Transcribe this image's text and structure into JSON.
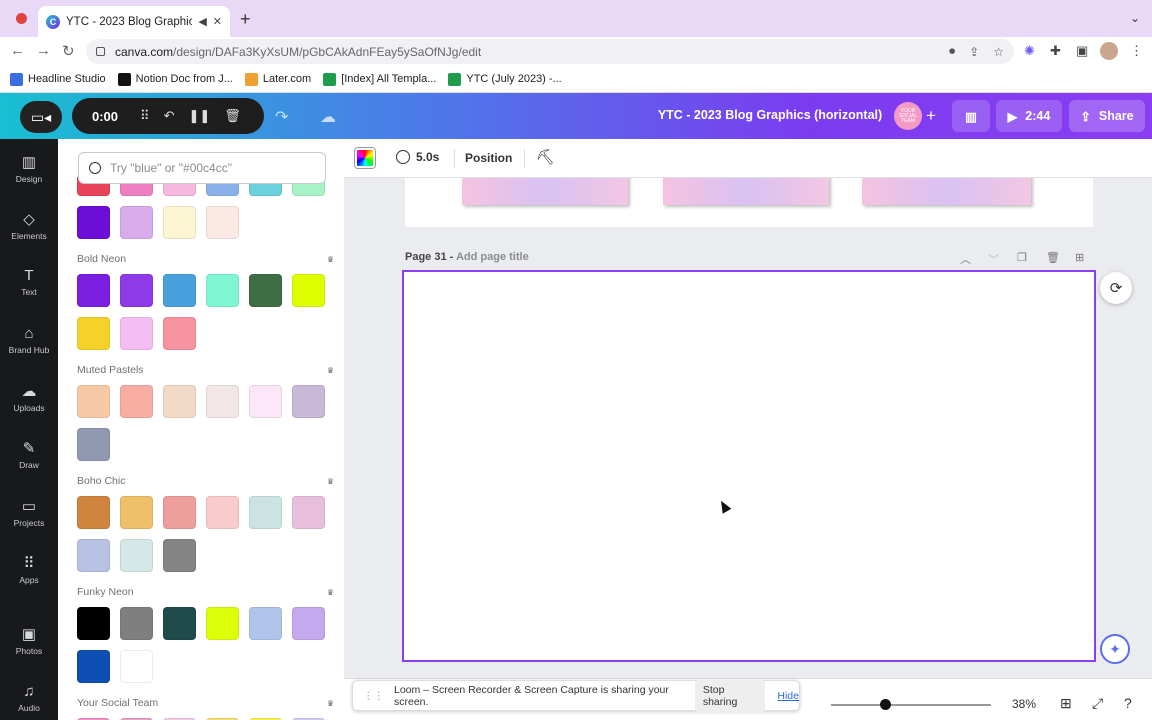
{
  "browser": {
    "tab_title": "YTC - 2023 Blog Graphics",
    "url_host": "canva.com",
    "url_path": "/design/DAFa3KyXsUM/pGbCAkAdnFEay5ySaOfNJg/edit",
    "bookmarks": [
      {
        "label": "Headline Studio",
        "color": "#3b6fe0"
      },
      {
        "label": "Notion Doc from J...",
        "color": "#111111"
      },
      {
        "label": "Later.com",
        "color": "#f0a030"
      },
      {
        "label": "[Index] All Templa...",
        "color": "#1e9e4a"
      },
      {
        "label": "YTC (July 2023) -...",
        "color": "#1e9e4a"
      }
    ]
  },
  "header": {
    "timer": "0:00",
    "doc_title": "YTC - 2023 Blog Graphics (horizontal)",
    "badge_text": "YOUR SOCIAL TEAM",
    "play_time": "2:44",
    "share_label": "Share"
  },
  "rail": [
    {
      "label": "Design",
      "icon": "design-icon",
      "glyph": "▥"
    },
    {
      "label": "Elements",
      "icon": "elements-icon",
      "glyph": "◇"
    },
    {
      "label": "Text",
      "icon": "text-icon",
      "glyph": "T"
    },
    {
      "label": "Brand Hub",
      "icon": "brand-hub-icon",
      "glyph": "⌂"
    },
    {
      "label": "Uploads",
      "icon": "uploads-icon",
      "glyph": "☁"
    },
    {
      "label": "Draw",
      "icon": "draw-icon",
      "glyph": "✎"
    },
    {
      "label": "Projects",
      "icon": "projects-icon",
      "glyph": "▭"
    },
    {
      "label": "Apps",
      "icon": "apps-icon",
      "glyph": "⠿"
    },
    {
      "label": "Photos",
      "icon": "photos-icon",
      "glyph": "▣"
    },
    {
      "label": "Audio",
      "icon": "audio-icon",
      "glyph": "♫"
    }
  ],
  "panel": {
    "search_placeholder": "Try \"blue\" or \"#00c4cc\"",
    "top_partial": [
      "#e9455a",
      "#ef7fc2",
      "#f6b8de",
      "#8ab0ea",
      "#6ad1dd",
      "#a8f2c8"
    ],
    "top_row2": [
      "#6a0ed8",
      "#d8acea",
      "#fcf5d2",
      "#fbe9e3"
    ],
    "palettes": [
      {
        "name": "Bold Neon",
        "colors": [
          "#7a1ee0",
          "#8f3ae8",
          "#4aa0dc",
          "#7ef7d2",
          "#3f6e44",
          "#ddff00",
          "#f5d22a",
          "#f3bef2",
          "#f6939e"
        ]
      },
      {
        "name": "Muted Pastels",
        "colors": [
          "#f8c9a6",
          "#f8ada3",
          "#f3dac7",
          "#f2e6e6",
          "#fbe7f7",
          "#c8b9d8",
          "#9099b1"
        ]
      },
      {
        "name": "Boho Chic",
        "colors": [
          "#d1843e",
          "#eec06a",
          "#ee9f9c",
          "#f8ccca",
          "#cce3e4",
          "#e8bfdb",
          "#b7c2e3",
          "#d4e8e7",
          "#848484"
        ]
      },
      {
        "name": "Funky Neon",
        "colors": [
          "#000000",
          "#7f7f7f",
          "#1f4b4b",
          "#dcff0a",
          "#b1c4ea",
          "#c4a9ee",
          "#0f4eb2",
          "#ffffff"
        ]
      },
      {
        "name": "Your Social Team",
        "colors": [
          "#f38fc6",
          "#e9a0c8",
          "#f2c7e2",
          "#f3dd6d",
          "#f9ef4c",
          "#d3c9f7"
        ]
      }
    ]
  },
  "editor": {
    "duration": "5.0s",
    "position_label": "Position",
    "page_label": "Page 31 -",
    "page_title_placeholder": "Add page title",
    "zoom": "38%"
  },
  "loom_notice": {
    "text": "Loom – Screen Recorder & Screen Capture is sharing your screen.",
    "stop": "Stop sharing",
    "hide": "Hide"
  }
}
